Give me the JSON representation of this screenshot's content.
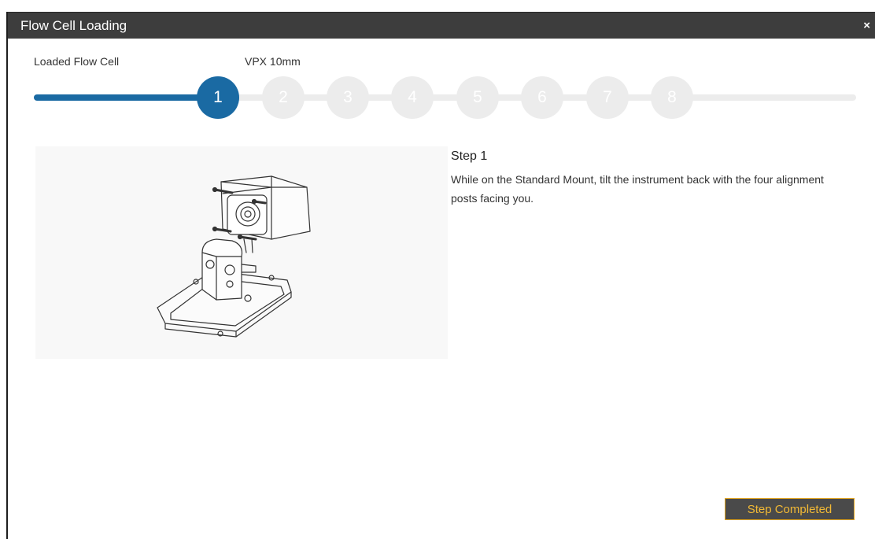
{
  "dialog": {
    "title": "Flow Cell Loading",
    "close_symbol": "×"
  },
  "header": {
    "left_label": "Loaded Flow Cell",
    "right_label": "VPX 10mm"
  },
  "progress": {
    "current_step": 1,
    "total_steps": 8,
    "steps": [
      "1",
      "2",
      "3",
      "4",
      "5",
      "6",
      "7",
      "8"
    ]
  },
  "content": {
    "step_title": "Step 1",
    "step_description": "While on the Standard Mount, tilt the instrument back with the four alignment posts facing you.",
    "illustration_icon": "instrument-on-standard-mount"
  },
  "footer": {
    "complete_label": "Step Completed"
  },
  "colors": {
    "titlebar": "#3d3d3d",
    "accent": "#1a6aa3",
    "inactive_step": "#ececec",
    "button_bg": "#4a4a4a",
    "button_text": "#f2b935"
  }
}
